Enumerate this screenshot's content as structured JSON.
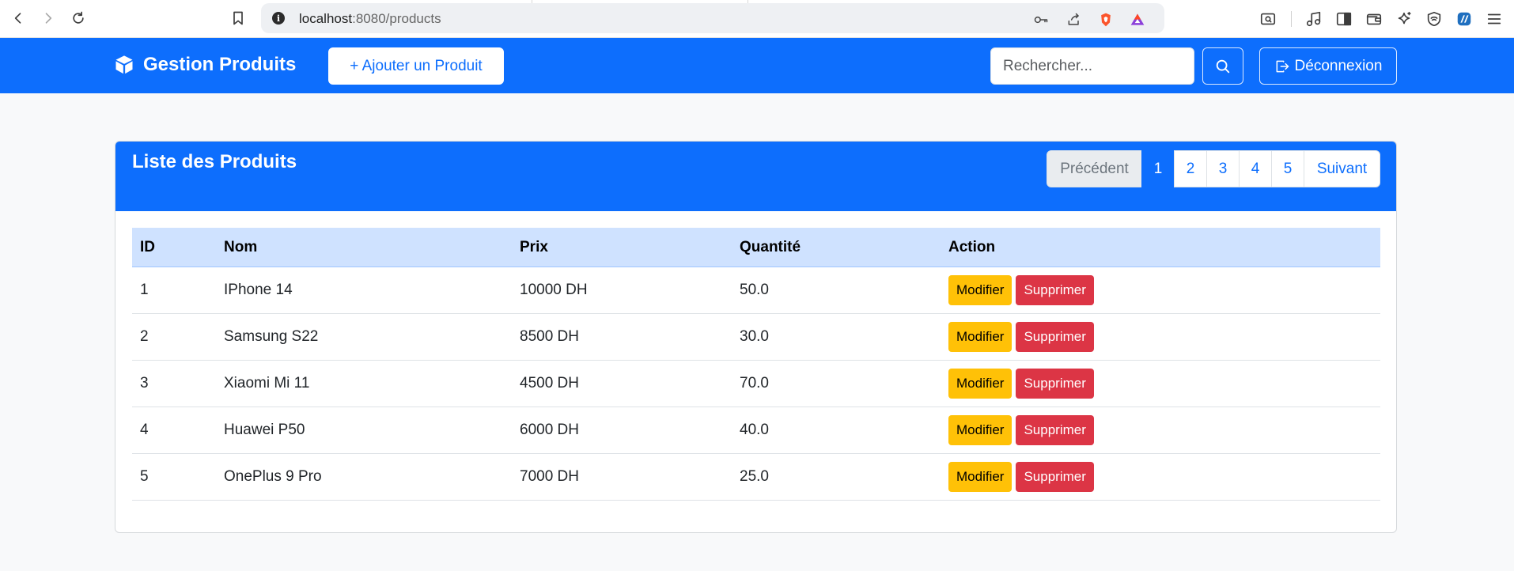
{
  "browser": {
    "url_host": "localhost",
    "url_rest": ":8080/products",
    "nav_icons": [
      "back-icon",
      "forward-icon",
      "reload-icon",
      "bookmark-icon"
    ],
    "url_icons": [
      "key-icon",
      "share-icon",
      "brave-shield-icon",
      "brave-rewards-icon"
    ],
    "toolbar_icons": [
      "reader-mode-icon",
      "media-icon",
      "sidebar-icon",
      "wallet-icon",
      "leo-ai-icon",
      "vpn-icon",
      "extension-icon",
      "menu-icon"
    ]
  },
  "navbar": {
    "brand": "Gestion Produits",
    "brand_icon": "box-icon",
    "add_button": "+ Ajouter un Produit",
    "search_placeholder": "Rechercher...",
    "logout_button": "Déconnexion"
  },
  "card": {
    "title": "Liste des Produits",
    "pagination": {
      "previous": "Précédent",
      "pages": [
        "1",
        "2",
        "3",
        "4",
        "5"
      ],
      "active_page": "1",
      "next": "Suivant"
    }
  },
  "table": {
    "headers": [
      "ID",
      "Nom",
      "Prix",
      "Quantité",
      "Action"
    ],
    "rows": [
      {
        "id": "1",
        "nom": "IPhone 14",
        "prix": "10000 DH",
        "quantite": "50.0"
      },
      {
        "id": "2",
        "nom": "Samsung S22",
        "prix": "8500 DH",
        "quantite": "30.0"
      },
      {
        "id": "3",
        "nom": "Xiaomi Mi 11",
        "prix": "4500 DH",
        "quantite": "70.0"
      },
      {
        "id": "4",
        "nom": "Huawei P50",
        "prix": "6000 DH",
        "quantite": "40.0"
      },
      {
        "id": "5",
        "nom": "OnePlus 9 Pro",
        "prix": "7000 DH",
        "quantite": "25.0"
      }
    ],
    "edit_label": "Modifier",
    "delete_label": "Supprimer"
  },
  "colors": {
    "primary": "#0d6efd",
    "warning": "#ffc107",
    "danger": "#dc3545",
    "table_header": "#cfe2ff"
  }
}
